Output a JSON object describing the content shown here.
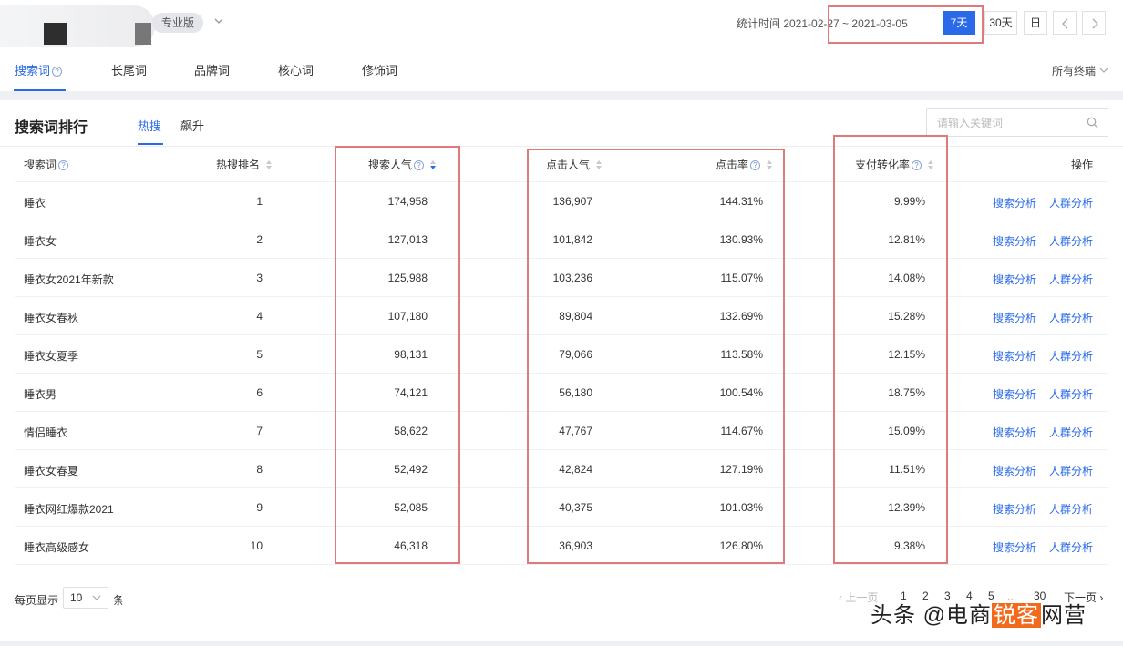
{
  "header": {
    "edition": "专业版",
    "stat_label": "统计时间 2021-02-27 ~ 2021-03-05",
    "range_7": "7天",
    "range_30": "30天",
    "range_day": "日",
    "terminal": "所有终端"
  },
  "main_tabs": [
    "搜索词",
    "长尾词",
    "品牌词",
    "核心词",
    "修饰词"
  ],
  "section": {
    "title": "搜索词排行",
    "sub_tabs": [
      "热搜",
      "飙升"
    ],
    "search_placeholder": "请输入关键词"
  },
  "columns": [
    "搜索词",
    "热搜排名",
    "搜索人气",
    "点击人气",
    "点击率",
    "支付转化率",
    "操作"
  ],
  "rows": [
    {
      "term": "睡衣",
      "rank": "1",
      "search_pop": "174,958",
      "click_pop": "136,907",
      "ctr": "144.31%",
      "conv": "9.99%"
    },
    {
      "term": "睡衣女",
      "rank": "2",
      "search_pop": "127,013",
      "click_pop": "101,842",
      "ctr": "130.93%",
      "conv": "12.81%"
    },
    {
      "term": "睡衣女2021年新款",
      "rank": "3",
      "search_pop": "125,988",
      "click_pop": "103,236",
      "ctr": "115.07%",
      "conv": "14.08%"
    },
    {
      "term": "睡衣女春秋",
      "rank": "4",
      "search_pop": "107,180",
      "click_pop": "89,804",
      "ctr": "132.69%",
      "conv": "15.28%"
    },
    {
      "term": "睡衣女夏季",
      "rank": "5",
      "search_pop": "98,131",
      "click_pop": "79,066",
      "ctr": "113.58%",
      "conv": "12.15%"
    },
    {
      "term": "睡衣男",
      "rank": "6",
      "search_pop": "74,121",
      "click_pop": "56,180",
      "ctr": "100.54%",
      "conv": "18.75%"
    },
    {
      "term": "情侣睡衣",
      "rank": "7",
      "search_pop": "58,622",
      "click_pop": "47,767",
      "ctr": "114.67%",
      "conv": "15.09%"
    },
    {
      "term": "睡衣女春夏",
      "rank": "8",
      "search_pop": "52,492",
      "click_pop": "42,824",
      "ctr": "127.19%",
      "conv": "11.51%"
    },
    {
      "term": "睡衣网红爆款2021",
      "rank": "9",
      "search_pop": "52,085",
      "click_pop": "40,375",
      "ctr": "101.03%",
      "conv": "12.39%"
    },
    {
      "term": "睡衣高级感女",
      "rank": "10",
      "search_pop": "46,318",
      "click_pop": "36,903",
      "ctr": "126.80%",
      "conv": "9.38%"
    }
  ],
  "actions": {
    "search_analysis": "搜索分析",
    "crowd_analysis": "人群分析"
  },
  "footer": {
    "per_page_label": "每页显示",
    "per_page_value": "10",
    "per_page_unit": "条",
    "prev": "上一页",
    "pages": [
      "1",
      "2",
      "3",
      "4",
      "5",
      "...",
      "30"
    ],
    "next": "下一页"
  },
  "watermark": {
    "prefix": "头条 @电商",
    "accent": "锐客",
    "suffix": "网营"
  },
  "colors": {
    "accent": "#2a6ae8",
    "highlight_box": "#e07a7a"
  }
}
